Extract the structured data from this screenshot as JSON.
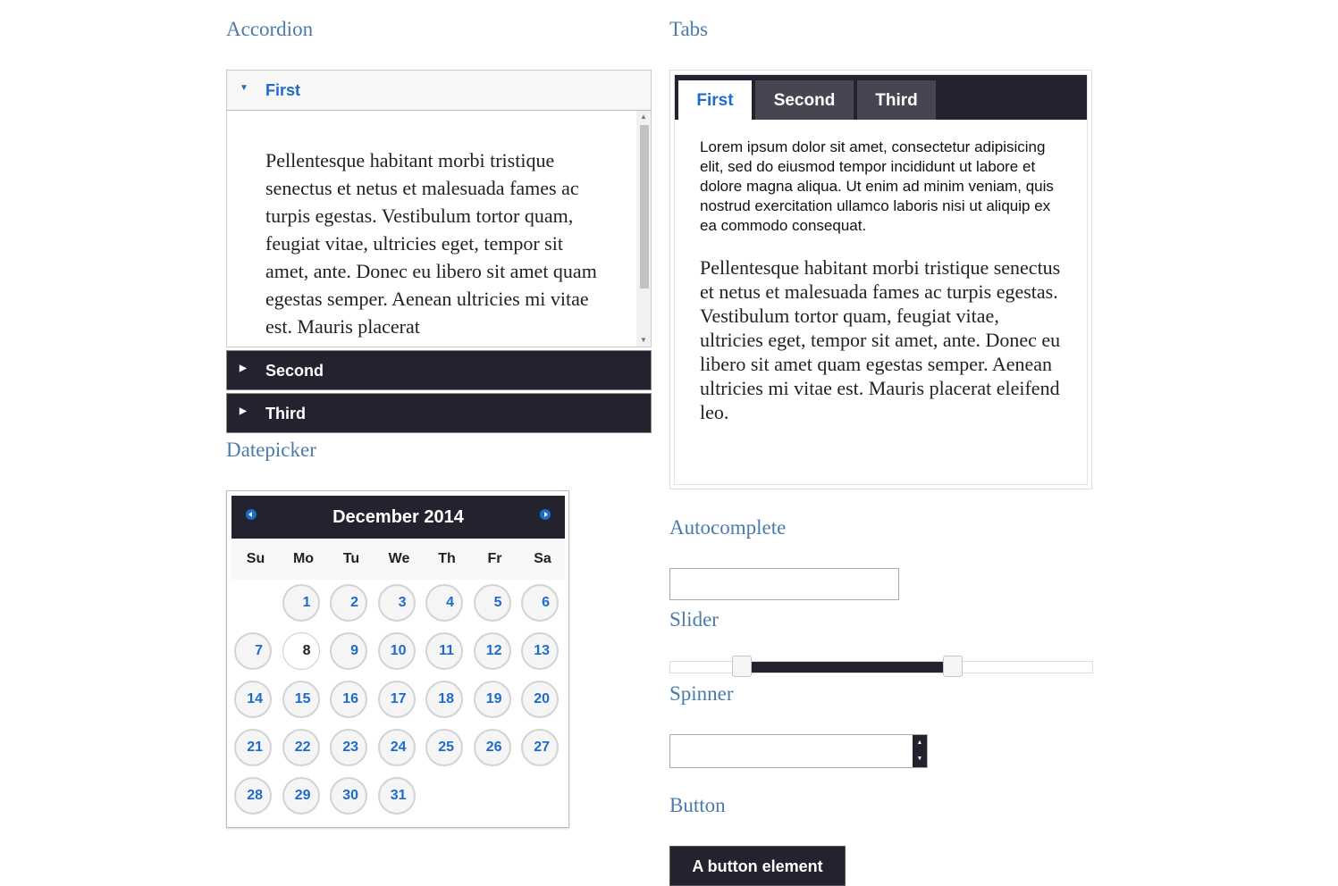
{
  "headings": {
    "accordion": "Accordion",
    "tabs": "Tabs",
    "datepicker": "Datepicker",
    "autocomplete": "Autocomplete",
    "slider": "Slider",
    "spinner": "Spinner",
    "button": "Button"
  },
  "accordion": {
    "sections": [
      {
        "label": "First",
        "expanded": true,
        "icon": "triangle-down-icon",
        "content": "Pellentesque habitant morbi tristique senectus et netus et malesuada fames ac turpis egestas. Vestibulum tortor quam, feugiat vitae, ultricies eget, tempor sit amet, ante. Donec eu libero sit amet quam egestas semper. Aenean ultricies mi vitae est. Mauris placerat"
      },
      {
        "label": "Second",
        "expanded": false,
        "icon": "triangle-right-icon"
      },
      {
        "label": "Third",
        "expanded": false,
        "icon": "triangle-right-icon"
      }
    ]
  },
  "tabs": {
    "items": [
      {
        "label": "First",
        "active": true
      },
      {
        "label": "Second",
        "active": false
      },
      {
        "label": "Third",
        "active": false
      }
    ],
    "content": {
      "p1": "Lorem ipsum dolor sit amet, consectetur adipisicing elit, sed do eiusmod tempor incididunt ut labore et dolore magna aliqua. Ut enim ad minim veniam, quis nostrud exercitation ullamco laboris nisi ut aliquip ex ea commodo consequat.",
      "p2": "Pellentesque habitant morbi tristique senectus et netus et malesuada fames ac turpis egestas. Vestibulum tortor quam, feugiat vitae, ultricies eget, tempor sit amet, ante. Donec eu libero sit amet quam egestas semper. Aenean ultricies mi vitae est. Mauris placerat eleifend leo."
    }
  },
  "datepicker": {
    "title": "December 2014",
    "prev_icon": "circle-triangle-left-icon",
    "next_icon": "circle-triangle-right-icon",
    "weekdays": [
      "Su",
      "Mo",
      "Tu",
      "We",
      "Th",
      "Fr",
      "Sa"
    ],
    "first_weekday_index": 1,
    "days_in_month": 31,
    "today": 8
  },
  "autocomplete": {
    "value": ""
  },
  "slider": {
    "min_percent": 17,
    "max_percent": 67
  },
  "spinner": {
    "value": "",
    "up_icon": "triangle-up-icon",
    "down_icon": "triangle-down-icon"
  },
  "button": {
    "label": "A button element"
  },
  "colors": {
    "accent": "#1d6ccb",
    "dark": "#22232f",
    "heading": "#4a7bab"
  }
}
